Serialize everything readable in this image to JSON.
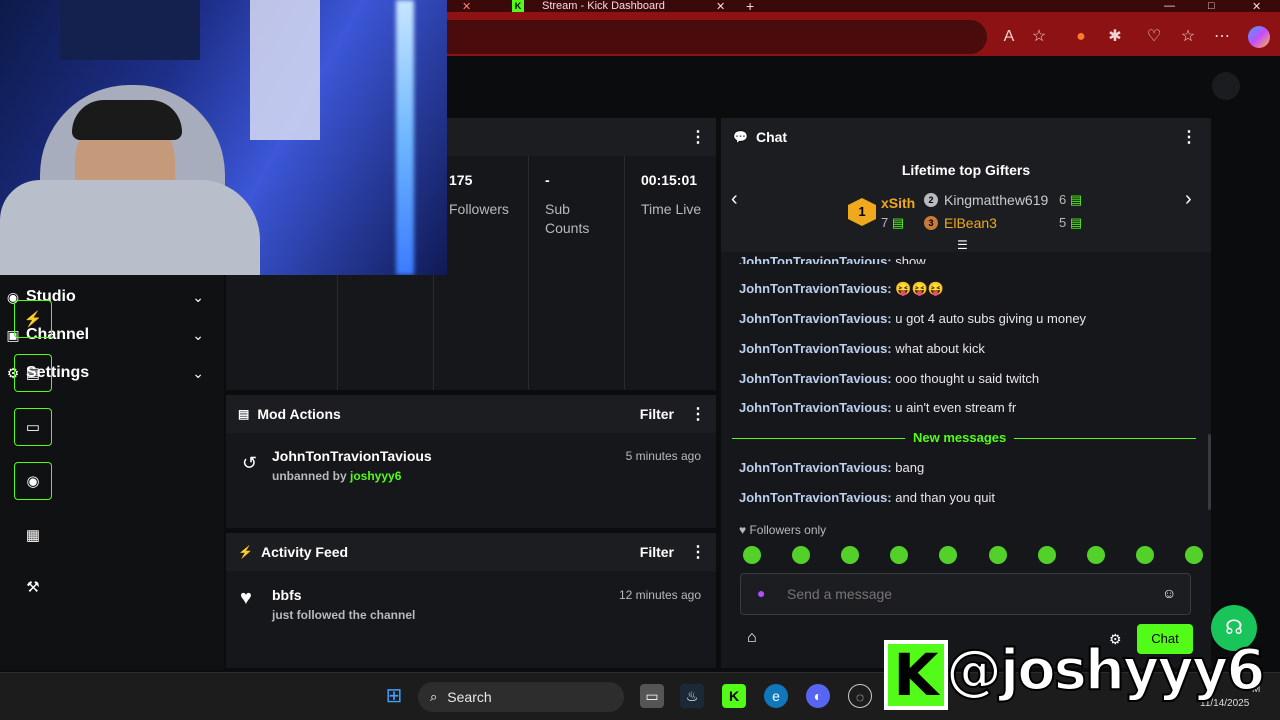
{
  "browser": {
    "tabs": [
      {
        "title": "Stream - Kick Dashboard"
      }
    ],
    "window_controls": {
      "minimize": "—",
      "maximize": "□",
      "close": "✕"
    },
    "new_tab": "+"
  },
  "stats": {
    "items": [
      {
        "value": "175",
        "label": "Followers"
      },
      {
        "value": "-",
        "label": "Sub Counts"
      },
      {
        "value": "00:15:01",
        "label": "Time Live"
      }
    ]
  },
  "nav": {
    "items": [
      {
        "label": "Studio"
      },
      {
        "label": "Channel"
      },
      {
        "label": "Settings"
      }
    ]
  },
  "mod_actions": {
    "title": "Mod Actions",
    "filter": "Filter",
    "entry": {
      "user": "JohnTonTravionTavious",
      "action_prefix": "unbanned by ",
      "actor": "joshyyy6",
      "time": "5 minutes ago"
    }
  },
  "activity_feed": {
    "title": "Activity Feed",
    "filter": "Filter",
    "entry": {
      "user": "bbfs",
      "action": "just followed the channel",
      "time": "12 minutes ago"
    }
  },
  "chat": {
    "title": "Chat",
    "gifters": {
      "title": "Lifetime top Gifters",
      "first": {
        "rank": "1",
        "name": "xSith",
        "count": "7"
      },
      "second": {
        "rank": "2",
        "name": "Kingmatthew619",
        "count": "6"
      },
      "third": {
        "rank": "3",
        "name": "ElBean3",
        "count": "5"
      }
    },
    "cut_message": {
      "user": "JohnTonTravionTavious:",
      "text": " show"
    },
    "messages": [
      {
        "user": "JohnTonTravionTavious:",
        "text": " 😝😝😝"
      },
      {
        "user": "JohnTonTravionTavious:",
        "text": " u got 4 auto subs giving u money"
      },
      {
        "user": "JohnTonTravionTavious:",
        "text": " what about kick"
      },
      {
        "user": "JohnTonTravionTavious:",
        "text": " ooo thought u said twitch"
      },
      {
        "user": "JohnTonTravionTavious:",
        "text": " u ain't even stream fr"
      }
    ],
    "new_messages_label": "New messages",
    "new_messages": [
      {
        "user": "JohnTonTravionTavious:",
        "text": " bang"
      },
      {
        "user": "JohnTonTravionTavious:",
        "text": " and than you quit"
      }
    ],
    "followers_only": "Followers only",
    "input_placeholder": "Send a message",
    "send_button": "Chat"
  },
  "taskbar": {
    "search": "Search",
    "clock_date": "11/14/2025",
    "clock_time": "M"
  },
  "overlay": {
    "brand": "K",
    "handle": "@joshyyy6"
  },
  "colors": {
    "kick_green": "#53fc18",
    "browser_red": "#8d1214",
    "panel_bg": "#16171a"
  }
}
